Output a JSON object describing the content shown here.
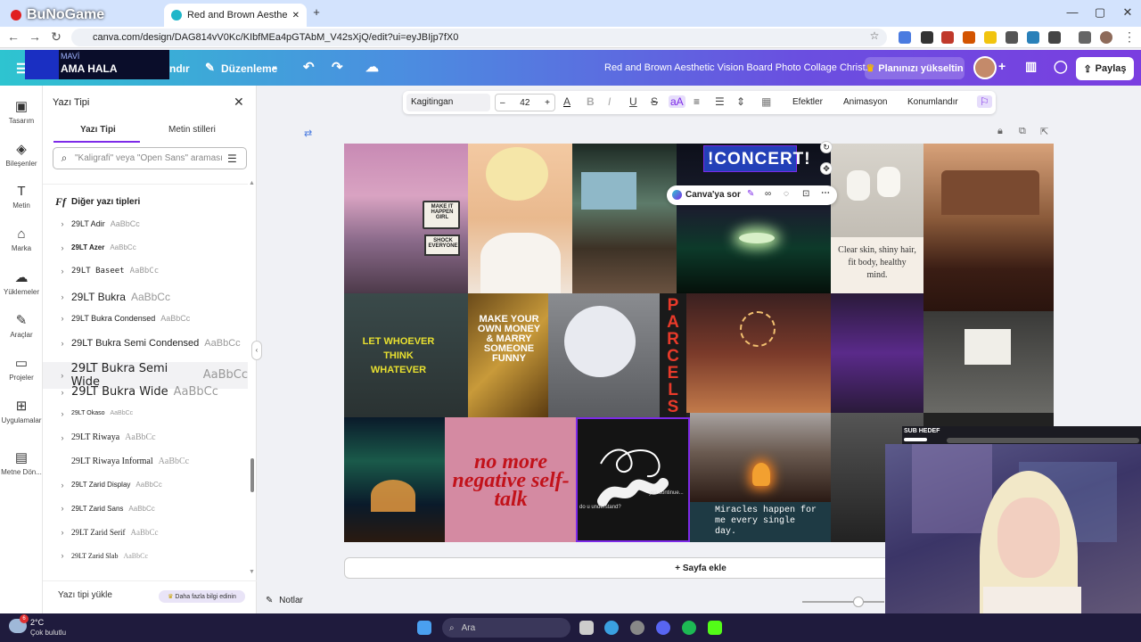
{
  "browser": {
    "tabs": [
      {
        "label": "BuNoGame"
      },
      {
        "label": "Red and Brown Aesthetic Vision"
      }
    ],
    "new_tab": "+",
    "url": "canva.com/design/DAG814vV0Kc/KIbfMEa4pGTAbM_V42sXjQ/edit?ui=eyJBIjp7fX0",
    "window_controls": {
      "minimize": "—",
      "maximize": "▢",
      "close": "✕"
    }
  },
  "stream_overlay": {
    "small": "MAVİ",
    "big": "AMA HALA"
  },
  "header": {
    "menu_trunc": "ndır",
    "edit_label": "Düzenleme",
    "doc_title": "Red and Brown Aesthetic Vision Board Photo Collage Christ...",
    "upgrade_label": "Planınızı yükseltin",
    "share_label": "Paylaş"
  },
  "rail": {
    "items": [
      {
        "label": "Tasarım",
        "icon": "▣"
      },
      {
        "label": "Bileşenler",
        "icon": "◈"
      },
      {
        "label": "Metin",
        "icon": "T"
      },
      {
        "label": "Marka",
        "icon": "⌂"
      },
      {
        "label": "Yüklemeler",
        "icon": "☁"
      },
      {
        "label": "Araçlar",
        "icon": "✎"
      },
      {
        "label": "Projeler",
        "icon": "▭"
      },
      {
        "label": "Uygulamalar",
        "icon": "⊞"
      },
      {
        "label": "Metne Dön...",
        "icon": "▤"
      }
    ]
  },
  "font_panel": {
    "title": "Yazı Tipi",
    "tab_fonts": "Yazı Tipi",
    "tab_styles": "Metin stilleri",
    "search_placeholder": "\"Kaligrafi\" veya \"Open Sans\" araması",
    "section_title": "Diğer yazı tipleri",
    "fonts": [
      {
        "name": "29LT Adir",
        "sample": "AaBbCc"
      },
      {
        "name": "29LT Azer",
        "sample": "AaBbCc"
      },
      {
        "name": "29LT Baseet",
        "sample": "AaBbCc"
      },
      {
        "name": "29LT Bukra",
        "sample": "AaBbCc"
      },
      {
        "name": "29LT Bukra Condensed",
        "sample": "AaBbCc"
      },
      {
        "name": "29LT Bukra Semi Condensed",
        "sample": "AaBbCc"
      },
      {
        "name": "29LT Bukra Semi Wide",
        "sample": "AaBbCc"
      },
      {
        "name": "29LT Bukra Wide",
        "sample": "AaBbCc"
      },
      {
        "name": "29LT Okaso",
        "sample": "AaBbCc"
      },
      {
        "name": "29LT Riwaya",
        "sample": "AaBbCc"
      },
      {
        "name": "29LT Riwaya Informal",
        "sample": "AaBbCc"
      },
      {
        "name": "29LT Zarid Display",
        "sample": "AaBbCc"
      },
      {
        "name": "29LT Zarid Sans",
        "sample": "AaBbCc"
      },
      {
        "name": "29LT Zarid Serif",
        "sample": "AaBbCc"
      },
      {
        "name": "29LT Zarid Slab",
        "sample": "AaBbCc"
      }
    ],
    "upload_label": "Yazı tipi yükle",
    "learn_more": "Daha fazla bilgi edinin"
  },
  "toolbar": {
    "font_name": "Kagitingan",
    "font_size": "42",
    "minus": "–",
    "plus": "+",
    "effects": "Efektler",
    "animation": "Animasyon",
    "position": "Konumlandır"
  },
  "context_menu": {
    "ask_label": "Canva'ya sor"
  },
  "collage": {
    "concert": "!CONCERT!",
    "make_it_happen": "MAKE IT HAPPEN GIRL",
    "shock_everyone": "SHOCK EVERYONE",
    "clear_skin": "Clear skin, shiny hair, fit body, healthy mind.",
    "let_whoever": "LET WHOEVER THINK WHATEVER",
    "make_money": "MAKE YOUR OWN MONEY & MARRY SOMEONE FUNNY",
    "parcels": "PARCELS",
    "no_more": "no more negative self-talk",
    "do_u": "do u understand?",
    "yes_continue": "yes continue...",
    "miracles": "Miracles happen for me every single day."
  },
  "add_page": "+ Sayfa ekle",
  "notes_label": "Notlar",
  "stream": {
    "sub_goal": "SUB HEDEF"
  },
  "taskbar": {
    "weather_temp": "2°C",
    "weather_desc": "Çok bulutlu",
    "search_label": "Ara"
  }
}
